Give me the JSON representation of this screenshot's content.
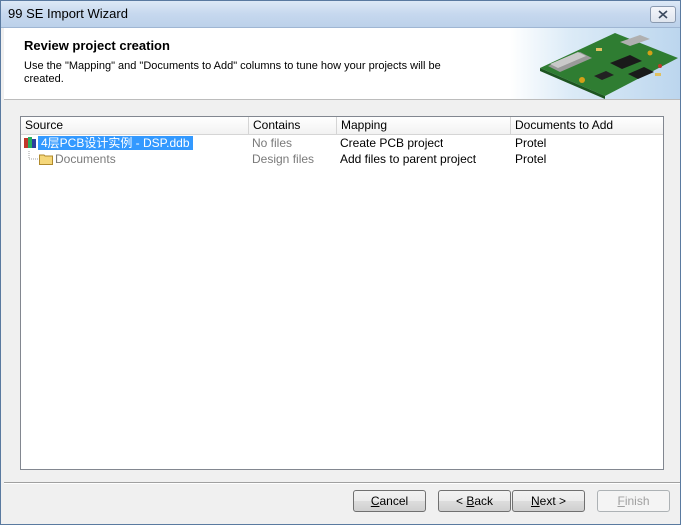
{
  "window": {
    "title": "99 SE Import Wizard"
  },
  "header": {
    "title": "Review project creation",
    "description": "Use the \"Mapping\" and \"Documents to Add\" columns to tune how your projects will be created."
  },
  "table": {
    "columns": [
      "Source",
      "Contains",
      "Mapping",
      "Documents to Add"
    ],
    "rows": [
      {
        "source": "4层PCB设计实例 - DSP.ddb",
        "contains": "No files",
        "mapping": "Create PCB project",
        "documents": "Protel",
        "icon": "ddb-database-icon",
        "selected": true
      },
      {
        "source": "Documents",
        "contains": "Design files",
        "mapping": "Add files to parent project",
        "documents": "Protel",
        "icon": "folder-icon",
        "selected": false
      }
    ]
  },
  "buttons": {
    "cancel_u": "C",
    "cancel_rest": "ancel",
    "back_pre": "< ",
    "back_u": "B",
    "back_rest": "ack",
    "next_u": "N",
    "next_rest": "ext >",
    "finish_u": "F",
    "finish_rest": "inish"
  },
  "colors": {
    "selection": "#3399ff",
    "titlebar": "#c6d8ee"
  }
}
